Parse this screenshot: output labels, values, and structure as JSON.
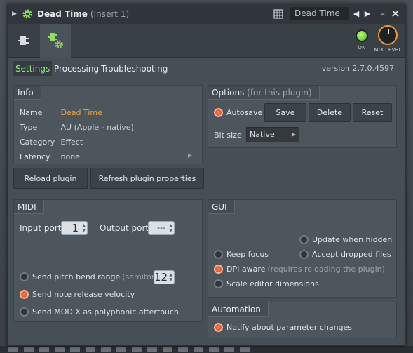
{
  "titlebar": {
    "title": "Dead Time",
    "insert": "(Insert 1)",
    "preset": "Dead Time",
    "prev_icon": "chevron-left-icon",
    "next_icon": "chevron-right-icon",
    "minimize": "–",
    "close": "✕"
  },
  "toolbar": {
    "on_label": "ON",
    "mix_label": "MIX LEVEL",
    "accent_color": "#f19a2a",
    "led_color": "#7bd33a"
  },
  "tabs": [
    {
      "label": "Settings",
      "active": true
    },
    {
      "label": "Processing",
      "active": false
    },
    {
      "label": "Troubleshooting",
      "active": false
    }
  ],
  "version": "version 2.7.0.4597",
  "info": {
    "title": "Info",
    "rows": [
      {
        "key": "Name",
        "value": "Dead Time"
      },
      {
        "key": "Type",
        "value": "AU (Apple - native)"
      },
      {
        "key": "Category",
        "value": "Effect"
      },
      {
        "key": "Latency",
        "value": "none"
      }
    ]
  },
  "buttons": {
    "reload": "Reload plugin",
    "refresh": "Refresh plugin properties"
  },
  "options": {
    "title": "Options",
    "subtitle": "(for this plugin)",
    "autosave": "Autosave",
    "save": "Save",
    "delete": "Delete",
    "reset": "Reset",
    "bitsize_label": "Bit size",
    "bitsize_value": "Native"
  },
  "midi": {
    "title": "MIDI",
    "input_label": "Input port",
    "input_value": "1",
    "output_label": "Output port",
    "output_value": "---",
    "pitch_bend": "Send pitch bend range",
    "pitch_bend_unit": "(semitones)",
    "pitch_bend_value": "12",
    "release_velocity": "Send note release velocity",
    "mod_x": "Send MOD X as polyphonic aftertouch"
  },
  "gui": {
    "title": "GUI",
    "update_hidden": "Update when hidden",
    "keep_focus": "Keep focus",
    "accept_dropped": "Accept dropped files",
    "dpi_aware": "DPI aware",
    "dpi_note": "(requires reloading the plugin)",
    "scale_editor": "Scale editor dimensions"
  },
  "automation": {
    "title": "Automation",
    "notify": "Notify about parameter changes"
  }
}
